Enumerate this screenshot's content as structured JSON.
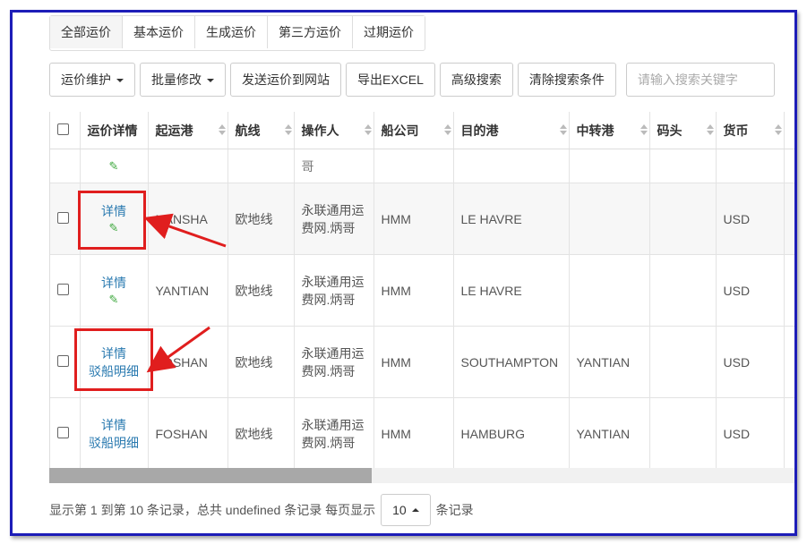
{
  "tabs": [
    {
      "label": "全部运价",
      "active": true
    },
    {
      "label": "基本运价",
      "active": false
    },
    {
      "label": "生成运价",
      "active": false
    },
    {
      "label": "第三方运价",
      "active": false
    },
    {
      "label": "过期运价",
      "active": false
    }
  ],
  "toolbar": {
    "maintain_label": "运价维护",
    "batch_edit_label": "批量修改",
    "send_label": "发送运价到网站",
    "export_label": "导出EXCEL",
    "advanced_search_label": "高级搜索",
    "clear_search_label": "清除搜索条件",
    "search_placeholder": "请输入搜索关键字"
  },
  "table": {
    "headers": [
      "运价详情",
      "起运港",
      "航线",
      "操作人",
      "船公司",
      "目的港",
      "中转港",
      "码头",
      "货币"
    ],
    "rows": [
      {
        "detail": "详情",
        "extra": "",
        "pol": "NANSHA",
        "route": "欧地线",
        "operator": "永联通用运费网.炳哥",
        "carrier": "HMM",
        "pod": "LE HAVRE",
        "transit": "",
        "terminal": "",
        "currency": "USD"
      },
      {
        "detail": "详情",
        "extra": "",
        "pol": "YANTIAN",
        "route": "欧地线",
        "operator": "永联通用运费网.炳哥",
        "carrier": "HMM",
        "pod": "LE HAVRE",
        "transit": "",
        "terminal": "",
        "currency": "USD"
      },
      {
        "detail": "详情",
        "extra": "驳船明细",
        "pol": "FOSHAN",
        "route": "欧地线",
        "operator": "永联通用运费网.炳哥",
        "carrier": "HMM",
        "pod": "SOUTHAMPTON",
        "transit": "YANTIAN",
        "terminal": "",
        "currency": "USD"
      },
      {
        "detail": "详情",
        "extra": "驳船明细",
        "pol": "FOSHAN",
        "route": "欧地线",
        "operator": "永联通用运费网.炳哥",
        "carrier": "HMM",
        "pod": "HAMBURG",
        "transit": "YANTIAN",
        "terminal": "",
        "currency": "USD"
      }
    ]
  },
  "pager": {
    "summary": "显示第 1 到第 10 条记录，总共 undefined 条记录 每页显示",
    "page_size": "10",
    "suffix": "条记录"
  },
  "colors": {
    "annotation": "#e01e1e",
    "link": "#2a7ab0",
    "frame": "#1d1db8"
  }
}
